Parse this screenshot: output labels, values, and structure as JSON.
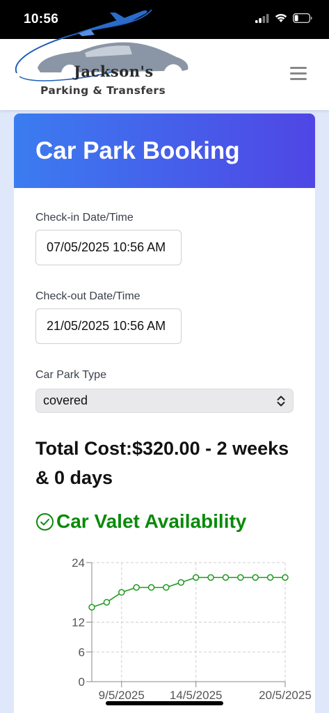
{
  "status_bar": {
    "time": "10:56"
  },
  "brand": {
    "line1": "Jackson's",
    "line2": "Parking & Transfers"
  },
  "form": {
    "title": "Car Park Booking",
    "checkin": {
      "label": "Check-in Date/Time",
      "value": "07/05/2025 10:56 AM"
    },
    "checkout": {
      "label": "Check-out Date/Time",
      "value": "21/05/2025 10:56 AM"
    },
    "car_park_type": {
      "label": "Car Park Type",
      "value": "covered"
    },
    "total_cost": "Total Cost:$320.00 - 2 weeks & 0 days"
  },
  "valet": {
    "title": "Car Valet Availability"
  },
  "colors": {
    "accent_start": "#3b7cf0",
    "accent_end": "#4f46e5",
    "valet_green": "#0a8a0a"
  },
  "chart_data": {
    "type": "line",
    "title": "",
    "xlabel": "",
    "ylabel": "",
    "x": [
      "7/5/2025",
      "8/5/2025",
      "9/5/2025",
      "10/5/2025",
      "11/5/2025",
      "12/5/2025",
      "13/5/2025",
      "14/5/2025",
      "15/5/2025",
      "16/5/2025",
      "17/5/2025",
      "18/5/2025",
      "19/5/2025",
      "20/5/2025"
    ],
    "x_ticks": [
      "9/5/2025",
      "14/5/2025",
      "20/5/2025"
    ],
    "y_ticks": [
      0,
      6,
      12,
      24
    ],
    "ylim": [
      0,
      24
    ],
    "series": [
      {
        "values": [
          15,
          16,
          18,
          19,
          19,
          19,
          20,
          21,
          21,
          21,
          21,
          21,
          21,
          21
        ]
      }
    ],
    "grid": true
  }
}
